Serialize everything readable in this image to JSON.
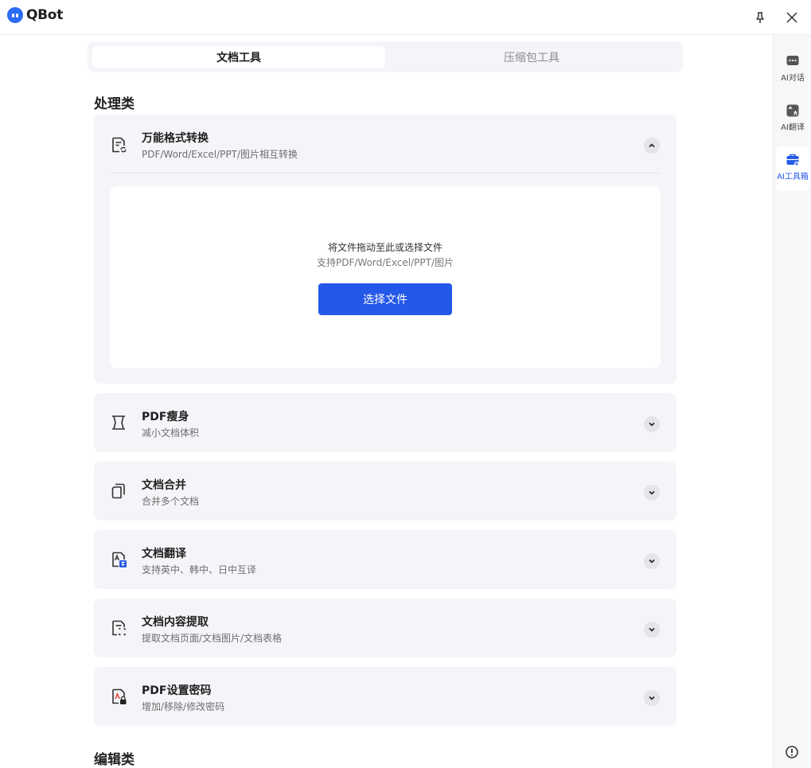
{
  "app": {
    "name": "QBot"
  },
  "tabs": [
    {
      "label": "文档工具",
      "active": true
    },
    {
      "label": "压缩包工具",
      "active": false
    }
  ],
  "sections": [
    {
      "title": "处理类"
    },
    {
      "title": "编辑类"
    }
  ],
  "cards": [
    {
      "title": "万能格式转换",
      "subtitle": "PDF/Word/Excel/PPT/图片相互转换",
      "icon": "format-convert-icon",
      "expanded": true
    },
    {
      "title": "PDF瘦身",
      "subtitle": "减小文档体积",
      "icon": "compress-icon",
      "expanded": false
    },
    {
      "title": "文档合并",
      "subtitle": "合并多个文档",
      "icon": "merge-icon",
      "expanded": false
    },
    {
      "title": "文档翻译",
      "subtitle": "支持英中、韩中、日中互译",
      "icon": "translate-icon",
      "expanded": false
    },
    {
      "title": "文档内容提取",
      "subtitle": "提取文档页面/文档图片/文档表格",
      "icon": "extract-icon",
      "expanded": false
    },
    {
      "title": "PDF设置密码",
      "subtitle": "增加/移除/修改密码",
      "icon": "pdf-lock-icon",
      "expanded": false
    }
  ],
  "dropzone": {
    "main_text": "将文件拖动至此或选择文件",
    "sub_text": "支持PDF/Word/Excel/PPT/图片",
    "button_label": "选择文件"
  },
  "sidebar": {
    "items": [
      {
        "label": "AI对话",
        "icon": "chat-icon",
        "active": false
      },
      {
        "label": "AI翻译",
        "icon": "translate-icon",
        "active": false
      },
      {
        "label": "AI工具箱",
        "icon": "toolbox-icon",
        "active": true
      }
    ]
  },
  "colors": {
    "accent": "#2458e8",
    "card_bg": "#f4f5f8",
    "sidebar_bg": "#f6f7f9"
  }
}
